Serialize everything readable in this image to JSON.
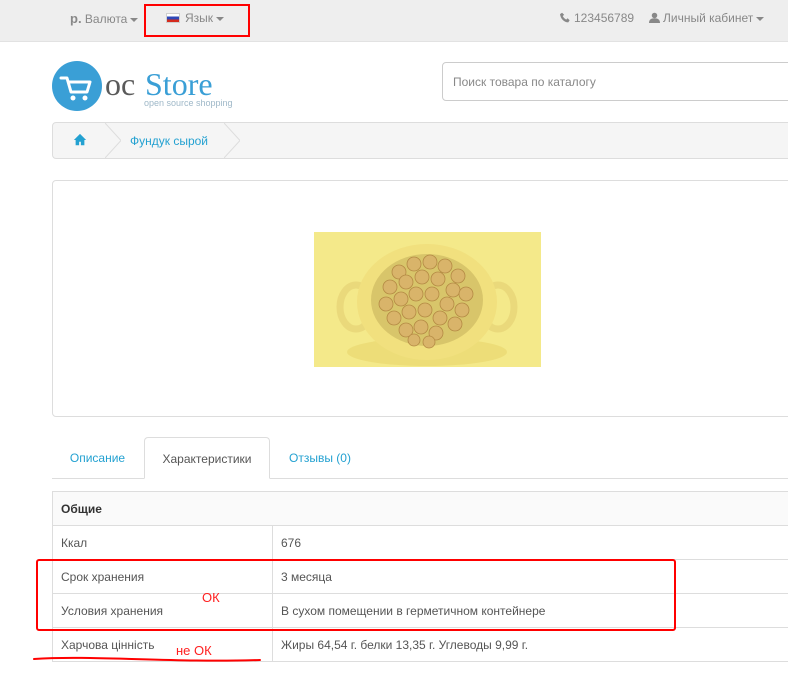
{
  "topbar": {
    "currency_symbol": "р.",
    "currency_label": "Валюта",
    "language_label": "Язык",
    "phone": "123456789",
    "account_label": "Личный кабинет"
  },
  "logo": {
    "oc": "oc",
    "store": "Store",
    "tagline": "open source shopping"
  },
  "search": {
    "placeholder": "Поиск товара по каталогу"
  },
  "breadcrumb": {
    "item": "Фундук сырой"
  },
  "tabs": [
    {
      "label": "Описание"
    },
    {
      "label": "Характеристики"
    },
    {
      "label": "Отзывы (0)"
    }
  ],
  "specs": {
    "group": "Общие",
    "rows": [
      {
        "name": "Ккал",
        "value": "676"
      },
      {
        "name": "Срок хранения",
        "value": "3 месяца"
      },
      {
        "name": "Условия хранения",
        "value": "В сухом помещении в герметичном контейнере"
      },
      {
        "name": "Харчова цінність",
        "value": "Жиры 64,54 г. белки 13,35 г. Углеводы 9,99 г."
      }
    ]
  },
  "annotations": {
    "ok": "ОК",
    "not_ok": "не ОК"
  },
  "colors": {
    "link": "#23a1d1",
    "brand_blue": "#3a9fd6",
    "annotation_red": "#ff0000"
  }
}
